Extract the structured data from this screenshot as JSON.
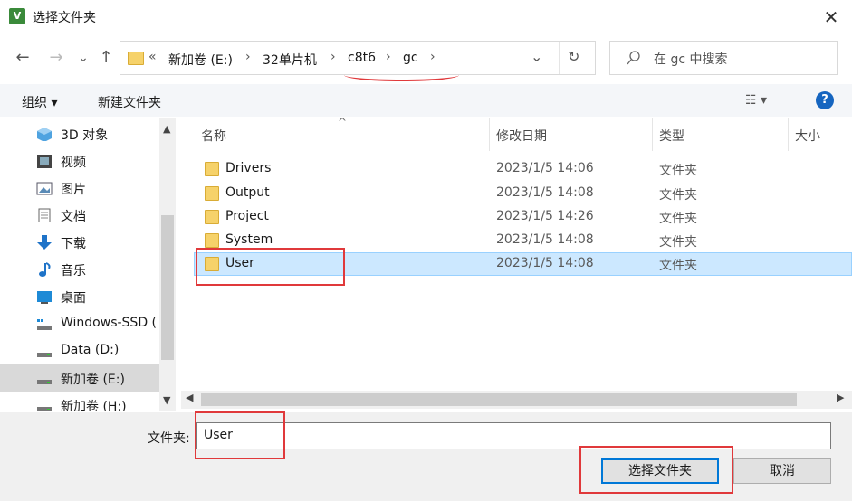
{
  "window": {
    "title": "选择文件夹",
    "close_glyph": "✕"
  },
  "nav": {
    "back": "←",
    "forward": "→",
    "history": "⌄",
    "up": "↑",
    "breadcrumb": [
      "«",
      "新加卷 (E:)",
      "32单片机",
      "c8t6",
      "gc"
    ],
    "crumb_sep": "›",
    "dropdown": "⌄",
    "refresh": "↻",
    "search_placeholder": "在 gc 中搜索"
  },
  "toolbar": {
    "organize": "组织 ▾",
    "new_folder": "新建文件夹",
    "view": "☷ ▾",
    "help": "?"
  },
  "sidebar": {
    "items": [
      {
        "label": "3D 对象",
        "icon": "cube-icon"
      },
      {
        "label": "视频",
        "icon": "video-icon"
      },
      {
        "label": "图片",
        "icon": "picture-icon"
      },
      {
        "label": "文档",
        "icon": "document-icon"
      },
      {
        "label": "下载",
        "icon": "download-icon"
      },
      {
        "label": "音乐",
        "icon": "music-icon"
      },
      {
        "label": "桌面",
        "icon": "desktop-icon"
      },
      {
        "label": "Windows-SSD (",
        "icon": "drive-icon"
      },
      {
        "label": "Data (D:)",
        "icon": "drive-icon"
      },
      {
        "label": "新加卷 (E:)",
        "icon": "drive-icon",
        "selected": true
      },
      {
        "label": "新加卷 (H:)",
        "icon": "drive-icon"
      }
    ]
  },
  "columns": {
    "name": "名称",
    "date": "修改日期",
    "type": "类型",
    "size": "大小",
    "sort_glyph": "^"
  },
  "files": [
    {
      "name": "Drivers",
      "date": "2023/1/5 14:06",
      "type": "文件夹"
    },
    {
      "name": "Output",
      "date": "2023/1/5 14:08",
      "type": "文件夹"
    },
    {
      "name": "Project",
      "date": "2023/1/5 14:26",
      "type": "文件夹"
    },
    {
      "name": "System",
      "date": "2023/1/5 14:08",
      "type": "文件夹"
    },
    {
      "name": "User",
      "date": "2023/1/5 14:08",
      "type": "文件夹",
      "selected": true
    }
  ],
  "footer": {
    "folder_label": "文件夹:",
    "folder_value": "User",
    "select_button": "选择文件夹",
    "cancel_button": "取消"
  }
}
